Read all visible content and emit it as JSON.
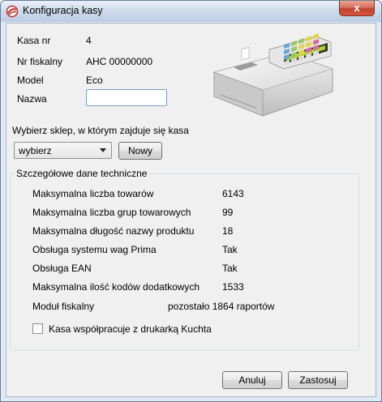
{
  "window": {
    "title": "Konfiguracja kasy",
    "close_symbol": "x"
  },
  "fields": {
    "kasa_nr": {
      "label": "Kasa nr",
      "value": "4"
    },
    "nr_fiskalny": {
      "label": "Nr fiskalny",
      "value": "AHC 00000000"
    },
    "model": {
      "label": "Model",
      "value": "Eco"
    },
    "nazwa": {
      "label": "Nazwa",
      "value": "",
      "placeholder": ""
    }
  },
  "shop": {
    "prompt": "Wybierz sklep, w którym zajduje się kasa",
    "selected": "wybierz",
    "new_button": "Nowy"
  },
  "tech": {
    "group_title": "Szczegółowe dane techniczne",
    "rows": [
      {
        "label": "Maksymalna liczba towarów",
        "value": "6143"
      },
      {
        "label": "Maksymalna liczba grup towarowych",
        "value": "99"
      },
      {
        "label": "Maksymalna długość nazwy produktu",
        "value": "18"
      },
      {
        "label": "Obsługa systemu wag Prima",
        "value": "Tak"
      },
      {
        "label": "Obsługa EAN",
        "value": "Tak"
      },
      {
        "label": "Maksymalna ilość kodów dodatkowych",
        "value": "1533"
      }
    ],
    "fiscal_module_label": "Moduł fiskalny",
    "fiscal_module_value": "pozostało 1864 raportów",
    "printer_checkbox_label": "Kasa współpracuje z drukarką Kuchta",
    "printer_checkbox_checked": false
  },
  "footer": {
    "cancel_label": "Anuluj",
    "apply_label": "Zastosuj"
  },
  "icons": {
    "app": "app-logo-icon",
    "register": "cash-register-icon"
  },
  "colors": {
    "close_button": "#c0412b",
    "titlebar": "#cfdcec",
    "client_bg": "#f0f0f0"
  }
}
